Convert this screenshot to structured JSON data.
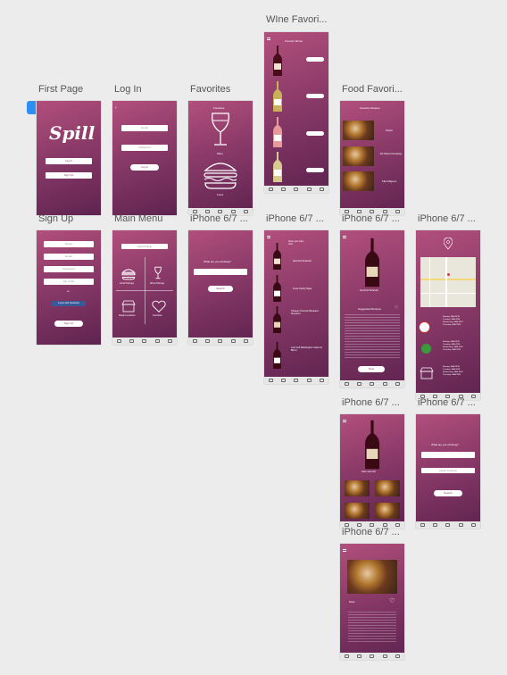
{
  "canvas": {
    "background": "#ececec",
    "accent": "#8a3a68",
    "selection_color": "#2f8ef5"
  },
  "artboards": {
    "first_page": {
      "title": "First Page",
      "logo": "Spill",
      "btn1": "Log In",
      "btn2": "Sign Up"
    },
    "log_in": {
      "title": "Log In",
      "field1": "Email",
      "field2": "Password",
      "btn": "Log In"
    },
    "favorites": {
      "title": "Favorites",
      "header": "Favorites",
      "label1": "Wine",
      "label2": "Food"
    },
    "wine_favorites": {
      "title": "WIne Favori...",
      "header": "Favorite Wines"
    },
    "food_favorites": {
      "title": "Food Favori...",
      "header": "Favorite Recipes",
      "items": [
        "Pasta",
        "Pot Sticker Dumplings",
        "Filet Mignon"
      ]
    },
    "sign_up": {
      "title": "Sign Up",
      "fields": [
        "Name",
        "Email",
        "Password",
        "Zip Code"
      ],
      "or": "or",
      "fb": "Log in with Facebook",
      "btn": "Sign Up"
    },
    "main_menu": {
      "title": "Main Menu",
      "search": "Search/Ship",
      "cells": [
        "Food Pairings",
        "Wine Pairings",
        "Retail Locations",
        "Favorites"
      ]
    },
    "iphone1": {
      "title": "iPhone 6/7 ...",
      "question": "What are you drinking?",
      "btn": "Search"
    },
    "iphone2": {
      "title": "iPhone 6/7 ...",
      "items": [
        "Sean your wine shot",
        "Sanchori Zinfandel",
        "Frank Family Napa",
        "Chateau Tournois Bordeaux Superieur",
        "Lord Colt Washington Cabernet Blend"
      ]
    },
    "iphone3": {
      "title": "iPhone 6/7 ...",
      "wine": "Sanchori Zinfandel",
      "heading": "Suggested Recipes",
      "btn": "Next"
    },
    "iphone4": {
      "title": "iPhone 6/7 ...",
      "hours": [
        "Monday: 9AM-9PM",
        "Tuesday: 9AM-9PM",
        "Wednesday: 9AM-9PM",
        "Thursday: 9AM-9PM"
      ]
    },
    "iphone5": {
      "title": "iPhone 6/7 ...",
      "heading": "Pairs well with"
    },
    "iphone6": {
      "title": "iPhone 6/7 ...",
      "question": "What are you drinking?",
      "field2": "Latest Location",
      "btn": "Search"
    },
    "iphone7": {
      "title": "iPhone 6/7 ...",
      "heading": "Pasta"
    }
  }
}
